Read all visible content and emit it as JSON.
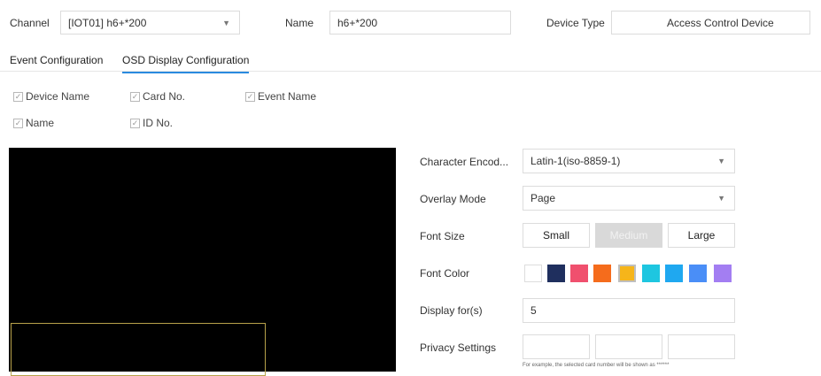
{
  "header": {
    "channel_label": "Channel",
    "channel_value": "[IOT01] h6+*200",
    "name_label": "Name",
    "name_value": "h6+*200",
    "device_type_label": "Device Type",
    "device_type_value": "Access Control Device"
  },
  "tabs": [
    {
      "label": "Event Configuration",
      "active": false
    },
    {
      "label": "OSD Display Configuration",
      "active": true
    }
  ],
  "checkboxes": [
    {
      "label": "Device Name",
      "checked": true
    },
    {
      "label": "Card No.",
      "checked": true
    },
    {
      "label": "Event Name",
      "checked": true
    },
    {
      "label": "Name",
      "checked": true
    },
    {
      "label": "ID No.",
      "checked": true
    }
  ],
  "settings": {
    "character_encoding_label": "Character Encod...",
    "character_encoding_value": "Latin-1(iso-8859-1)",
    "overlay_mode_label": "Overlay Mode",
    "overlay_mode_value": "Page",
    "font_size_label": "Font Size",
    "font_sizes": [
      "Small",
      "Medium",
      "Large"
    ],
    "font_size_selected": "Medium",
    "font_color_label": "Font Color",
    "font_colors": [
      "#ffffff",
      "#1f2f5e",
      "#f0506e",
      "#f56c1c",
      "#f6b51a",
      "#1ec6e0",
      "#1fa8f0",
      "#4a8ef7",
      "#a37ef2"
    ],
    "display_for_label": "Display for(s)",
    "display_for_value": "5",
    "privacy_label": "Privacy Settings",
    "privacy_hint": "For example, the selected card number will be shown as ******"
  },
  "colors": {
    "accent": "#2a8adf",
    "preview_bg": "#000000",
    "preview_region_border": "#b8a24a"
  },
  "icons": {
    "dropdown": "chevron-down-icon",
    "checkbox": "checkbox-icon"
  }
}
